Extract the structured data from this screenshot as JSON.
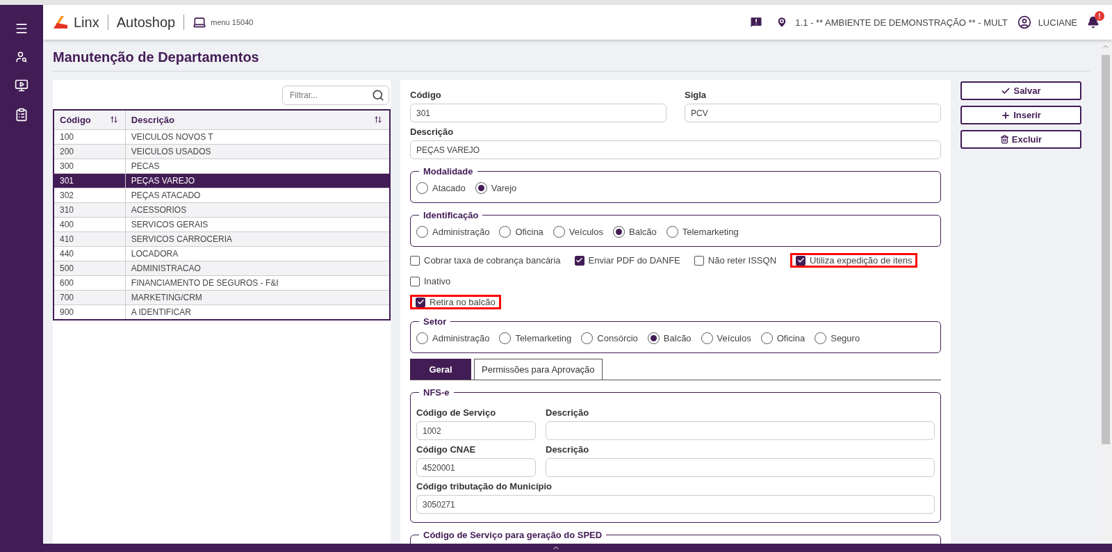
{
  "header": {
    "brand": "Linx",
    "product": "Autoshop",
    "menu": "menu 15040",
    "environment": "1.1 - ** AMBIENTE DE DEMONSTRAÇÃO ** - MULT",
    "user": "LUCIANE",
    "notification_badge": "!"
  },
  "page_title": "Manutenção de Departamentos",
  "filter": {
    "placeholder": "Filtrar..."
  },
  "table": {
    "columns": [
      "Código",
      "Descrição"
    ],
    "rows": [
      {
        "cells": [
          "100",
          "VEICULOS NOVOS T"
        ],
        "selected": false
      },
      {
        "cells": [
          "200",
          "VEICULOS USADOS"
        ],
        "selected": false
      },
      {
        "cells": [
          "300",
          "PECAS"
        ],
        "selected": false
      },
      {
        "cells": [
          "301",
          "PEÇAS VAREJO"
        ],
        "selected": true
      },
      {
        "cells": [
          "302",
          "PEÇAS ATACADO"
        ],
        "selected": false
      },
      {
        "cells": [
          "310",
          "ACESSORIOS"
        ],
        "selected": false
      },
      {
        "cells": [
          "400",
          "SERVICOS GERAIS"
        ],
        "selected": false
      },
      {
        "cells": [
          "410",
          "SERVICOS CARROCERIA"
        ],
        "selected": false
      },
      {
        "cells": [
          "440",
          "LOCADORA"
        ],
        "selected": false
      },
      {
        "cells": [
          "500",
          "ADMINISTRACAO"
        ],
        "selected": false
      },
      {
        "cells": [
          "600",
          "FINANCIAMENTO DE SEGUROS - F&I"
        ],
        "selected": false
      },
      {
        "cells": [
          "700",
          "MARKETING/CRM"
        ],
        "selected": false
      },
      {
        "cells": [
          "900",
          "A IDENTIFICAR"
        ],
        "selected": false
      }
    ]
  },
  "form": {
    "codigo": {
      "label": "Código",
      "value": "301"
    },
    "sigla": {
      "label": "Sigla",
      "value": "PCV"
    },
    "descricao": {
      "label": "Descrição",
      "value": "PEÇAS VAREJO"
    },
    "modalidade": {
      "legend": "Modalidade",
      "options": [
        {
          "label": "Atacado",
          "selected": false
        },
        {
          "label": "Varejo",
          "selected": true
        }
      ]
    },
    "identificacao": {
      "legend": "Identificação",
      "options": [
        {
          "label": "Administração",
          "selected": false
        },
        {
          "label": "Oficina",
          "selected": false
        },
        {
          "label": "Veículos",
          "selected": false
        },
        {
          "label": "Balcão",
          "selected": true
        },
        {
          "label": "Telemarketing",
          "selected": false
        }
      ]
    },
    "checkbox_rows": [
      [
        {
          "label": "Cobrar taxa de cobrança bancária",
          "checked": false,
          "highlighted": false
        },
        {
          "label": "Enviar PDF do DANFE",
          "checked": true,
          "highlighted": false
        },
        {
          "label": "Não reter ISSQN",
          "checked": false,
          "highlighted": false
        },
        {
          "label": "Utiliza expedição de itens",
          "checked": true,
          "highlighted": true
        }
      ],
      [
        {
          "label": "Inativo",
          "checked": false,
          "highlighted": false
        }
      ],
      [
        {
          "label": "Retira no balcão",
          "checked": true,
          "highlighted": true
        }
      ]
    ],
    "setor": {
      "legend": "Setor",
      "options": [
        {
          "label": "Administração",
          "selected": false
        },
        {
          "label": "Telemarketing",
          "selected": false
        },
        {
          "label": "Consórcio",
          "selected": false
        },
        {
          "label": "Balcão",
          "selected": true
        },
        {
          "label": "Veículos",
          "selected": false
        },
        {
          "label": "Oficina",
          "selected": false
        },
        {
          "label": "Seguro",
          "selected": false
        }
      ]
    },
    "tabs": [
      {
        "label": "Geral",
        "selected": true
      },
      {
        "label": "Permissões para Aprovação",
        "selected": false
      }
    ],
    "nfse": {
      "legend": "NFS-e",
      "rows": [
        [
          {
            "label": "Código de Serviço",
            "value": "1002"
          },
          {
            "label": "Descrição"
          }
        ],
        [
          {
            "label": "Código CNAE",
            "value": "4520001"
          },
          {
            "label": "Descrição"
          }
        ],
        [
          {
            "label": "Código tributação do Município",
            "value": "3050271"
          }
        ]
      ]
    },
    "sped": {
      "legend": "Código de Serviço para geração do SPED"
    }
  },
  "buttons": [
    {
      "label": "Salvar",
      "kind": "save"
    },
    {
      "label": "Inserir",
      "kind": "insert"
    },
    {
      "label": "Excluir",
      "kind": "delete"
    }
  ]
}
